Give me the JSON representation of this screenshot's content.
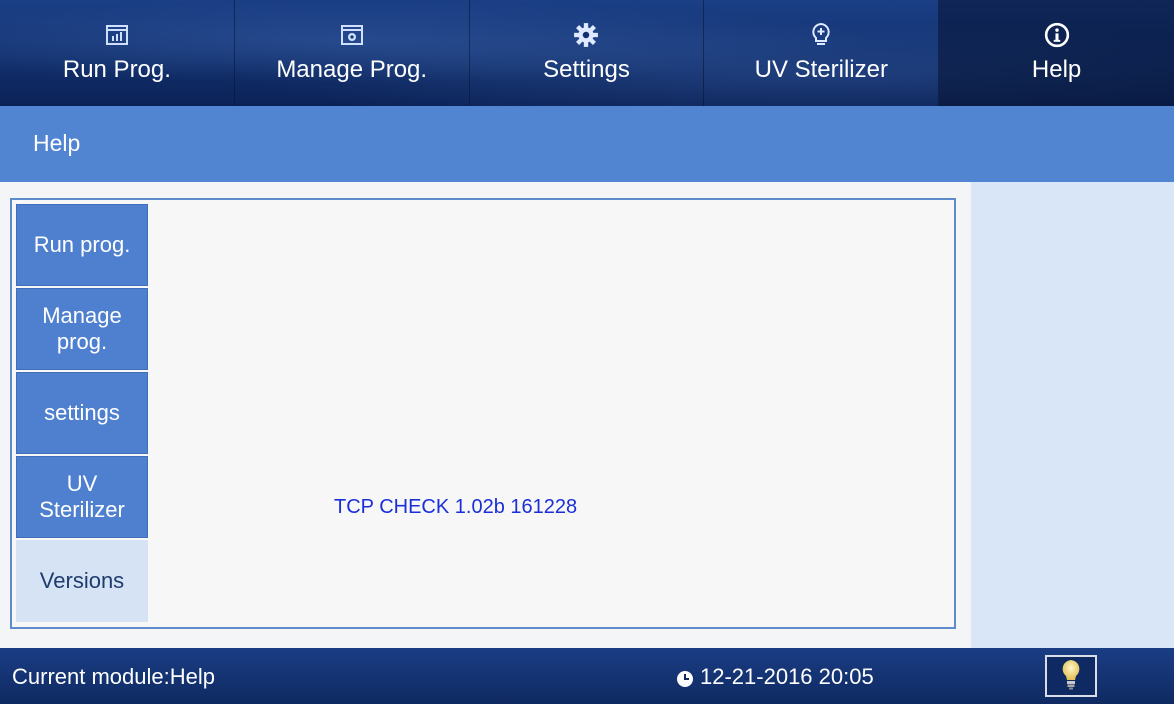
{
  "nav": {
    "tabs": [
      {
        "label": "Run Prog.",
        "icon": "chart-icon"
      },
      {
        "label": "Manage Prog.",
        "icon": "calendar-gear-icon"
      },
      {
        "label": "Settings",
        "icon": "gear-icon"
      },
      {
        "label": "UV Sterilizer",
        "icon": "bulb-plus-icon"
      },
      {
        "label": "Help",
        "icon": "info-icon"
      }
    ],
    "active": "Help"
  },
  "section": {
    "title": "Help"
  },
  "sidemenu": {
    "items": [
      {
        "label": "Run prog."
      },
      {
        "label": "Manage prog."
      },
      {
        "label": "settings"
      },
      {
        "label": "UV Sterilizer"
      },
      {
        "label": "Versions"
      }
    ],
    "active": "Versions"
  },
  "content": {
    "version": "TCP CHECK 1.02b 161228"
  },
  "status": {
    "module": "Current module:Help",
    "datetime": "12-21-2016 20:05"
  },
  "colors": {
    "nav_bg": "#12306d",
    "title_bar": "#5185d2",
    "side_item": "#4f80cf",
    "side_item_active": "#d5e3f5",
    "version_text": "#1a2fd8"
  }
}
